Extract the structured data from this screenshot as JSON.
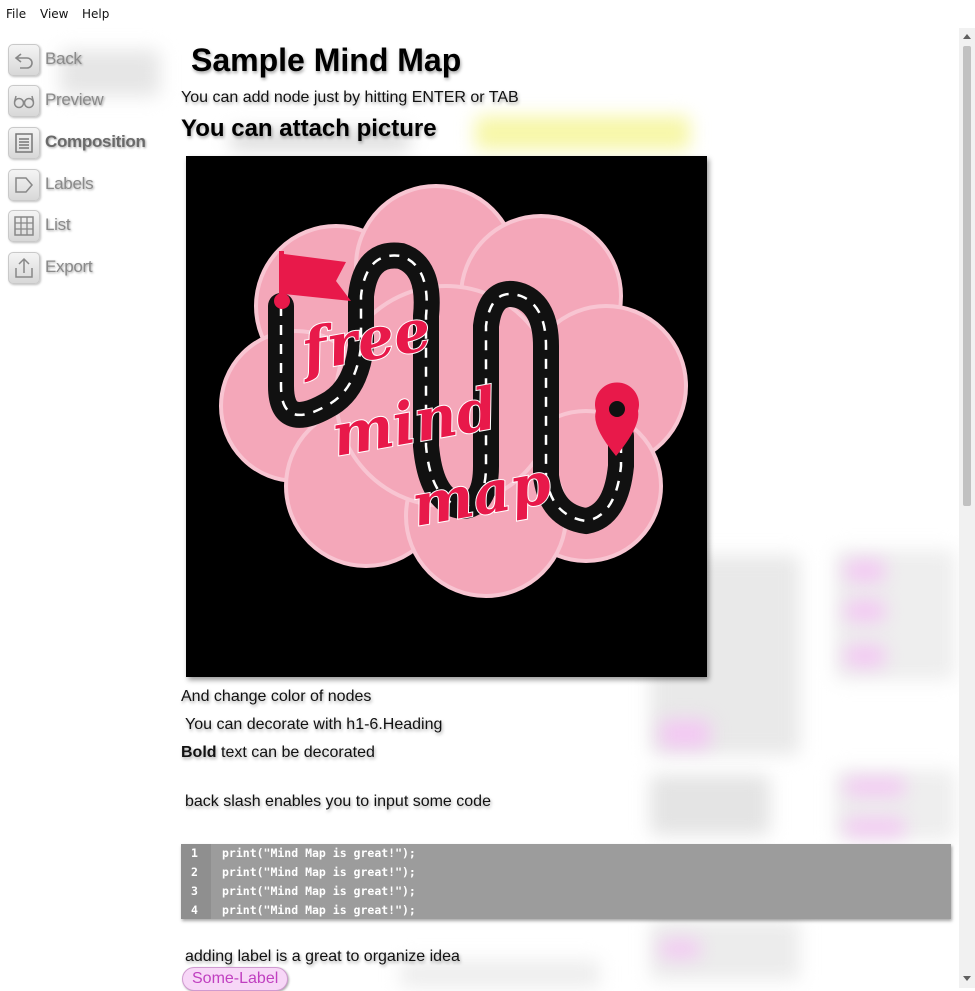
{
  "menu": [
    "File",
    "View",
    "Help"
  ],
  "sidebar": {
    "items": [
      {
        "label": "Back",
        "icon": "back-arrow-icon"
      },
      {
        "label": "Preview",
        "icon": "glasses-icon"
      },
      {
        "label": "Composition",
        "icon": "document-lines-icon"
      },
      {
        "label": "Labels",
        "icon": "tag-icon"
      },
      {
        "label": "List",
        "icon": "grid-list-icon"
      },
      {
        "label": "Export",
        "icon": "export-upload-icon"
      }
    ],
    "active": "Composition"
  },
  "content": {
    "title": "Sample Mind Map",
    "tip": "You can add node just by hitting ENTER or TAB",
    "attach_heading": "You can attach picture",
    "picture_logo_text": "free mind map",
    "color_text": "And change color of nodes",
    "heading_text": "You can decorate with h1-6.Heading",
    "bold_word": "Bold",
    "bold_rest": " text can be decorated",
    "code_intro": "back slash enables you to input some code",
    "code_lines": [
      {
        "num": "1",
        "text": "print(\"Mind Map is great!\");"
      },
      {
        "num": "2",
        "text": "print(\"Mind Map is great!\");"
      },
      {
        "num": "3",
        "text": "print(\"Mind Map is great!\");"
      },
      {
        "num": "4",
        "text": "print(\"Mind Map is great!\");"
      }
    ],
    "label_text": "adding label is a great to organize idea",
    "label_chip": "Some-Label"
  },
  "colors": {
    "code_background": "#9c9c9c",
    "label_chip_text": "#c040c0",
    "label_chip_background": "#f7d7f7",
    "brain_pink": "#f4a7b9",
    "logo_red": "#e8194a"
  }
}
